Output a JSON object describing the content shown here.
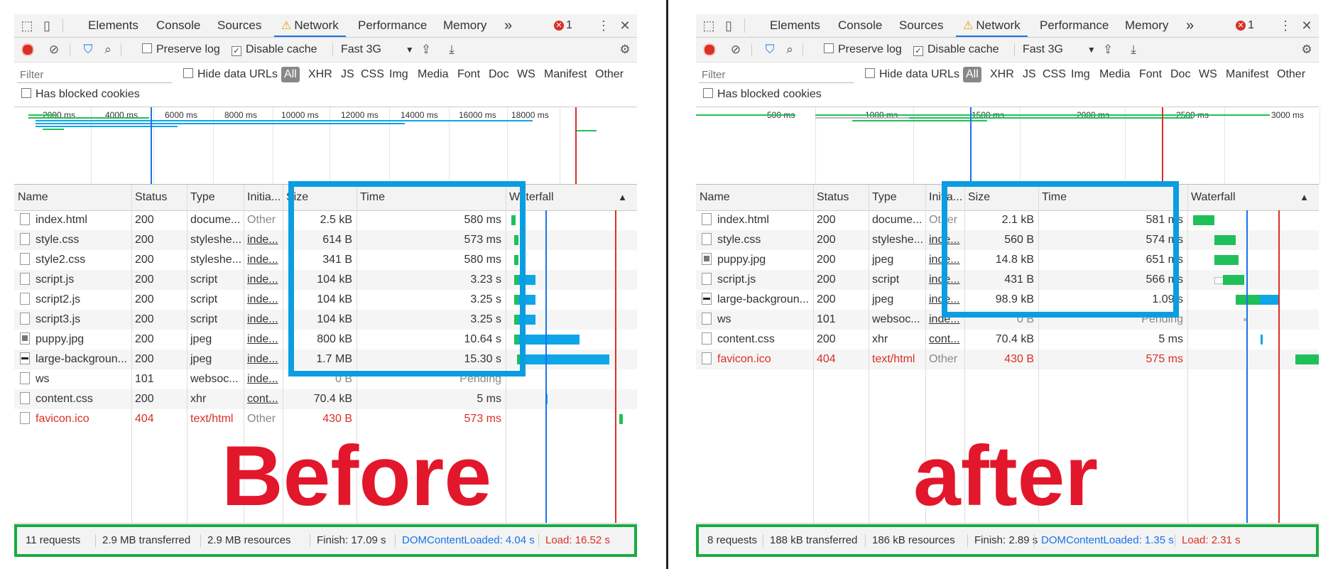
{
  "tabs": [
    "Elements",
    "Console",
    "Sources",
    "Network",
    "Performance",
    "Memory"
  ],
  "more_tabs": "»",
  "error_count": "1",
  "toolbar": {
    "preserve_log": "Preserve log",
    "disable_cache": "Disable cache",
    "throttle": "Fast 3G",
    "throttle_arrow": "▼"
  },
  "filter": {
    "placeholder": "Filter",
    "hide_data_urls": "Hide data URLs",
    "types": [
      "All",
      "XHR",
      "JS",
      "CSS",
      "Img",
      "Media",
      "Font",
      "Doc",
      "WS",
      "Manifest",
      "Other"
    ],
    "has_blocked_cookies": "Has blocked cookies"
  },
  "columns": [
    "Name",
    "Status",
    "Type",
    "Initia...",
    "Size",
    "Time",
    "Waterfall"
  ],
  "sort_arrow": "▲",
  "before": {
    "label": "Before",
    "overview_ticks": [
      "2000 ms",
      "4000 ms",
      "6000 ms",
      "8000 ms",
      "10000 ms",
      "12000 ms",
      "14000 ms",
      "16000 ms",
      "18000 ms"
    ],
    "rows": [
      {
        "name": "index.html",
        "status": "200",
        "type": "docume...",
        "initiator": "Other",
        "size": "2.5 kB",
        "time": "580 ms",
        "icon": "doc"
      },
      {
        "name": "style.css",
        "status": "200",
        "type": "styleshe...",
        "initiator": "inde...",
        "size": "614 B",
        "time": "573 ms",
        "icon": "doc"
      },
      {
        "name": "style2.css",
        "status": "200",
        "type": "styleshe...",
        "initiator": "inde...",
        "size": "341 B",
        "time": "580 ms",
        "icon": "doc"
      },
      {
        "name": "script.js",
        "status": "200",
        "type": "script",
        "initiator": "inde...",
        "size": "104 kB",
        "time": "3.23 s",
        "icon": "doc"
      },
      {
        "name": "script2.js",
        "status": "200",
        "type": "script",
        "initiator": "inde...",
        "size": "104 kB",
        "time": "3.25 s",
        "icon": "doc"
      },
      {
        "name": "script3.js",
        "status": "200",
        "type": "script",
        "initiator": "inde...",
        "size": "104 kB",
        "time": "3.25 s",
        "icon": "doc"
      },
      {
        "name": "puppy.jpg",
        "status": "200",
        "type": "jpeg",
        "initiator": "inde...",
        "size": "800 kB",
        "time": "10.64 s",
        "icon": "img"
      },
      {
        "name": "large-backgroun...",
        "status": "200",
        "type": "jpeg",
        "initiator": "inde...",
        "size": "1.7 MB",
        "time": "15.30 s",
        "icon": "dark"
      },
      {
        "name": "ws",
        "status": "101",
        "type": "websoc...",
        "initiator": "inde...",
        "size": "0 B",
        "time": "Pending",
        "icon": "doc"
      },
      {
        "name": "content.css",
        "status": "200",
        "type": "xhr",
        "initiator": "cont...",
        "size": "70.4 kB",
        "time": "5 ms",
        "icon": "doc"
      },
      {
        "name": "favicon.ico",
        "status": "404",
        "type": "text/html",
        "initiator": "Other",
        "size": "430 B",
        "time": "573 ms",
        "icon": "doc",
        "error": true
      }
    ],
    "status": {
      "requests": "11 requests",
      "transferred": "2.9 MB transferred",
      "resources": "2.9 MB resources",
      "finish": "Finish: 17.09 s",
      "dcl": "DOMContentLoaded: 4.04 s",
      "load": "Load: 16.52 s"
    }
  },
  "after": {
    "label": "after",
    "overview_ticks": [
      "500 ms",
      "1000 ms",
      "1500 ms",
      "2000 ms",
      "2500 ms",
      "3000 ms"
    ],
    "rows": [
      {
        "name": "index.html",
        "status": "200",
        "type": "docume...",
        "initiator": "Other",
        "size": "2.1 kB",
        "time": "581 ms",
        "icon": "doc"
      },
      {
        "name": "style.css",
        "status": "200",
        "type": "styleshe...",
        "initiator": "inde...",
        "size": "560 B",
        "time": "574 ms",
        "icon": "doc"
      },
      {
        "name": "puppy.jpg",
        "status": "200",
        "type": "jpeg",
        "initiator": "inde...",
        "size": "14.8 kB",
        "time": "651 ms",
        "icon": "img"
      },
      {
        "name": "script.js",
        "status": "200",
        "type": "script",
        "initiator": "inde...",
        "size": "431 B",
        "time": "566 ms",
        "icon": "doc"
      },
      {
        "name": "large-backgroun...",
        "status": "200",
        "type": "jpeg",
        "initiator": "inde...",
        "size": "98.9 kB",
        "time": "1.09 s",
        "icon": "dark"
      },
      {
        "name": "ws",
        "status": "101",
        "type": "websoc...",
        "initiator": "inde...",
        "size": "0 B",
        "time": "Pending",
        "icon": "doc"
      },
      {
        "name": "content.css",
        "status": "200",
        "type": "xhr",
        "initiator": "cont...",
        "size": "70.4 kB",
        "time": "5 ms",
        "icon": "doc"
      },
      {
        "name": "favicon.ico",
        "status": "404",
        "type": "text/html",
        "initiator": "Other",
        "size": "430 B",
        "time": "575 ms",
        "icon": "doc",
        "error": true
      }
    ],
    "status": {
      "requests": "8 requests",
      "transferred": "188 kB transferred",
      "resources": "186 kB resources",
      "finish": "Finish: 2.89 s",
      "dcl": "DOMContentLoaded: 1.35 s",
      "load": "Load: 2.31 s"
    }
  },
  "colors": {
    "highlight_blue": "#0b9de2",
    "status_green": "#1aab42",
    "label_red": "#e2172b",
    "dcl_blue": "#1a73e8",
    "load_red": "#d93025"
  }
}
